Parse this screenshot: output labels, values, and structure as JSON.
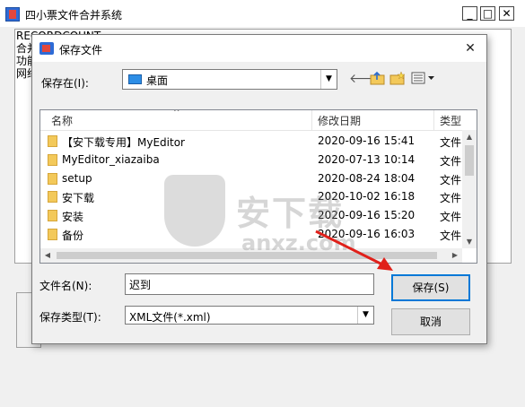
{
  "app": {
    "title": "四小票文件合并系统",
    "window_buttons": {
      "minimize": "_",
      "maximize": "□",
      "close": "✕"
    },
    "background_text": "RECORDCOUNT  ...\n合并\n功能\n网络"
  },
  "dialog": {
    "title": "保存文件",
    "close_glyph": "✕",
    "save_in_label": "保存在(I):",
    "save_in_value": "桌面",
    "toolbar_icons": [
      "back-arrow-icon",
      "up-folder-icon",
      "new-folder-icon",
      "view-menu-icon"
    ],
    "columns": {
      "name": "名称",
      "date": "修改日期",
      "type": "类型"
    },
    "files": [
      {
        "name": "【安下载专用】MyEditor",
        "date": "2020-09-16 15:41",
        "type": "文件"
      },
      {
        "name": "MyEditor_xiazaiba",
        "date": "2020-07-13 10:14",
        "type": "文件"
      },
      {
        "name": "setup",
        "date": "2020-08-24 18:04",
        "type": "文件"
      },
      {
        "name": "安下载",
        "date": "2020-10-02 16:18",
        "type": "文件"
      },
      {
        "name": "安装",
        "date": "2020-09-16 15:20",
        "type": "文件"
      },
      {
        "name": "备份",
        "date": "2020-09-16 16:03",
        "type": "文件"
      }
    ],
    "filename_label": "文件名(N):",
    "filename_value": "迟到",
    "filetype_label": "保存类型(T):",
    "filetype_value": "XML文件(*.xml)",
    "save_button": "保存(S)",
    "cancel_button": "取消"
  },
  "watermark": {
    "cn": "安下载",
    "en": "anxz.com"
  },
  "colors": {
    "accent": "#0078d7",
    "arrow": "#e0201a",
    "folder": "#f3c95a"
  }
}
